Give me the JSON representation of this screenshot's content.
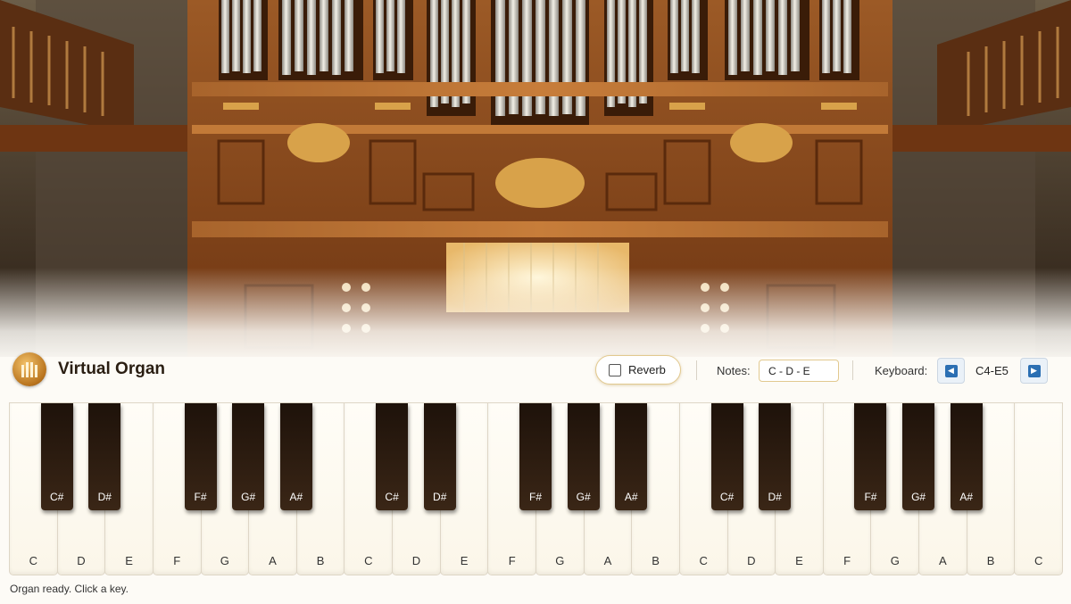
{
  "app": {
    "title": "Virtual Organ",
    "logo_icon": "organ-pipes-icon"
  },
  "controls": {
    "reverb_label": "Reverb",
    "reverb_checked": false,
    "notes_label": "Notes:",
    "notes_value": "C - D - E",
    "keyboard_label": "Keyboard:",
    "range_label": "C4-E5",
    "prev_icon": "arrow-left-icon",
    "next_icon": "arrow-right-icon"
  },
  "keys": {
    "white": [
      "C",
      "D",
      "E",
      "F",
      "G",
      "A",
      "B",
      "C",
      "D",
      "E",
      "F",
      "G",
      "A",
      "B",
      "C",
      "D",
      "E",
      "F",
      "G",
      "A",
      "B",
      "C"
    ],
    "black": [
      "C#",
      "D#",
      "F#",
      "G#",
      "A#",
      "C#",
      "D#",
      "F#",
      "G#",
      "A#",
      "C#",
      "D#",
      "F#",
      "G#",
      "A#"
    ]
  },
  "status": "Organ ready. Click a key.",
  "colors": {
    "accent_border": "#e2c98f",
    "wood": "#8a4a1c",
    "nav_blue": "#2b6fb3"
  }
}
